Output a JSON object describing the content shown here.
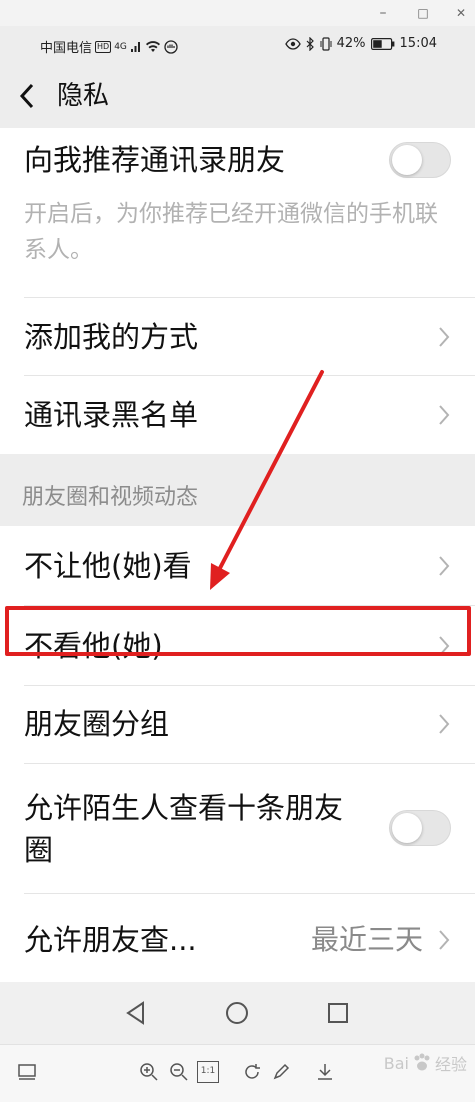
{
  "viewer": {
    "minimize_label": "–",
    "maximize_label": "□",
    "close_label": "✕"
  },
  "status_bar": {
    "carrier": "中国电信",
    "hd": "HD",
    "network": "4G",
    "battery": "42%",
    "time": "15:04"
  },
  "header": {
    "title": "隐私"
  },
  "settings": {
    "recommend_contacts": {
      "label": "向我推荐通讯录朋友",
      "description": "开启后，为你推荐已经开通微信的手机联系人。",
      "enabled": false
    },
    "add_me_methods": {
      "label": "添加我的方式"
    },
    "contacts_blacklist": {
      "label": "通讯录黑名单"
    },
    "moments_section": {
      "title": "朋友圈和视频动态"
    },
    "dont_let_see": {
      "label": "不让他(她)看"
    },
    "dont_see": {
      "label": "不看他(她)"
    },
    "moments_groups": {
      "label": "朋友圈分组"
    },
    "stranger_ten_posts": {
      "label_line1": "允许陌生人查看十条朋友",
      "label_line2": "圈",
      "enabled": false
    },
    "friends_view_range": {
      "label": "允许朋友查...",
      "value": "最近三天"
    }
  },
  "annotation": {
    "color": "#e02020"
  },
  "watermark": {
    "text": "Bai",
    "suffix": "经验"
  },
  "toolbar": {
    "zoom_actual": "1:1"
  }
}
